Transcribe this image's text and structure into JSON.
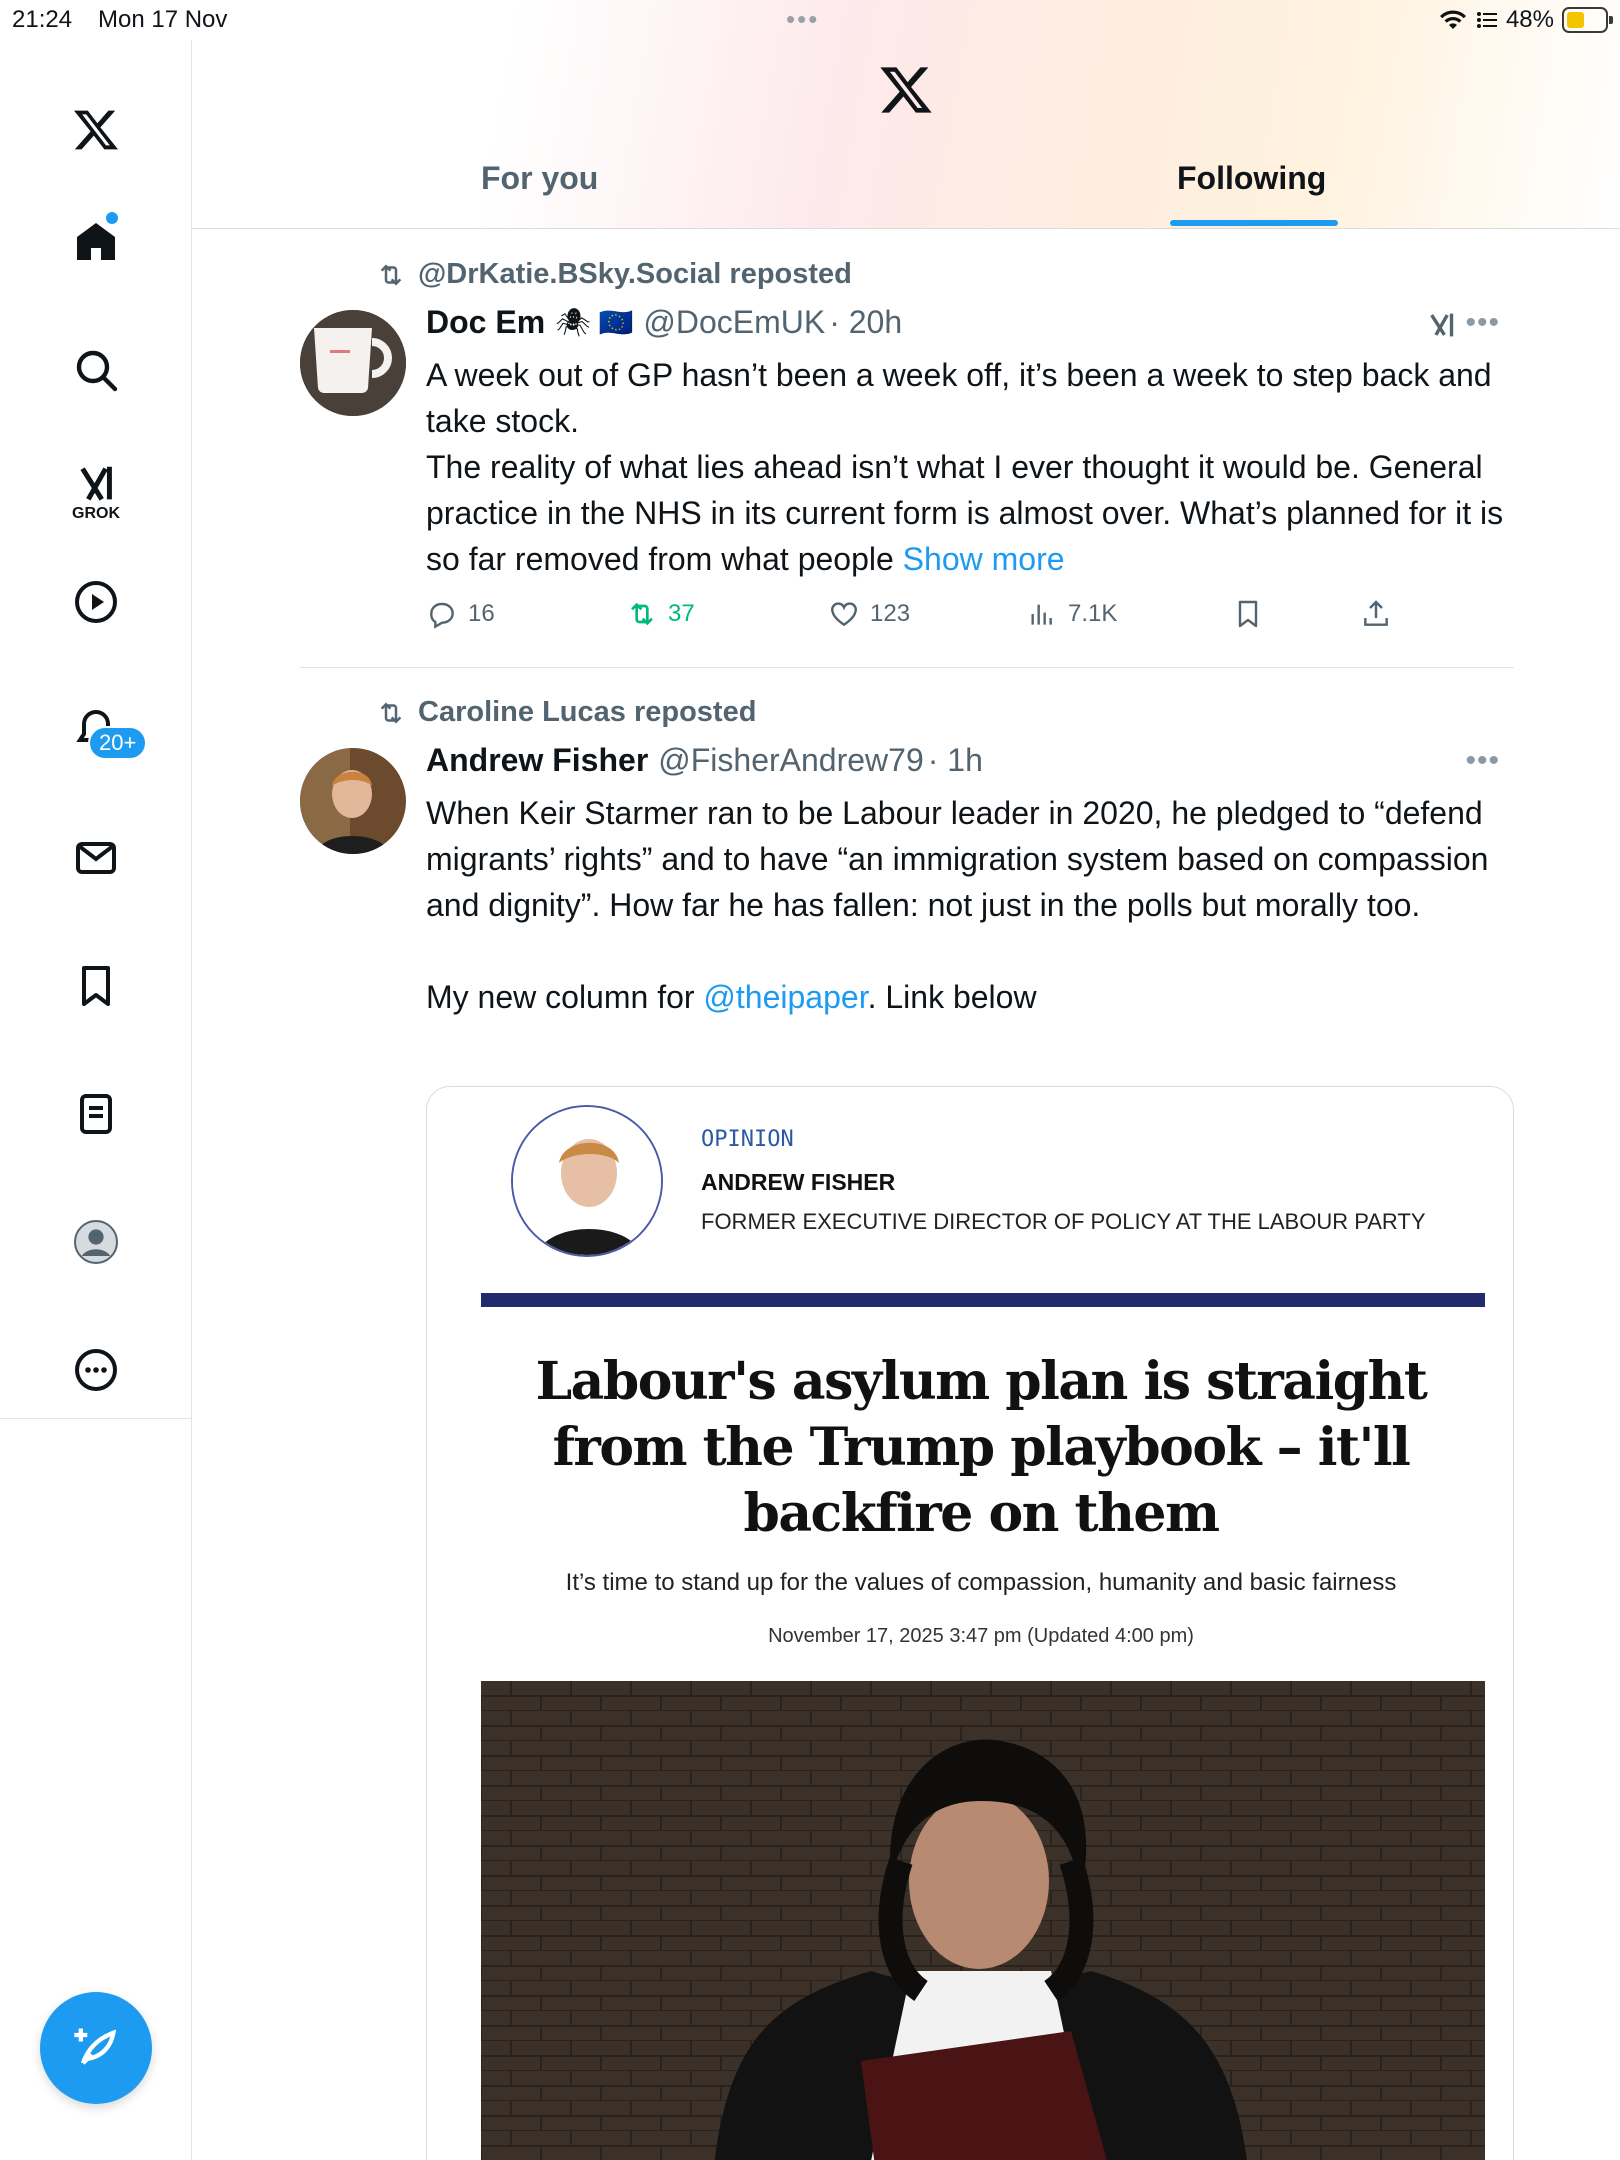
{
  "status_bar": {
    "time": "21:24",
    "date": "Mon 17 Nov",
    "battery": "48%"
  },
  "sidebar": {
    "items": [
      "x-logo",
      "home",
      "search",
      "grok",
      "video",
      "notifications",
      "messages",
      "bookmarks",
      "lists",
      "profile",
      "more"
    ],
    "grok_label": "GROK",
    "notifications_badge": "20+"
  },
  "tabs": {
    "for_you": "For you",
    "following": "Following",
    "active": "Following"
  },
  "tweets": [
    {
      "repost_by": "@DrKatie.BSky.Social reposted",
      "name": "Doc Em",
      "name_emoji": "🕷 🇪🇺",
      "handle": "@DocEmUK",
      "time": "· 20h",
      "text_1": "A week out of GP hasn’t been a week off, it’s been a week to step back and take stock.",
      "text_2": "The reality of what lies ahead isn’t what I ever thought it would be. General practice in the NHS in its current form is almost over. What’s planned for it is so far removed from what people",
      "show_more": "Show more",
      "replies": "16",
      "reposts": "37",
      "likes": "123",
      "views": "7.1K"
    },
    {
      "repost_by": "Caroline Lucas reposted",
      "name": "Andrew Fisher",
      "handle": "@FisherAndrew79",
      "time": "· 1h",
      "text_1": "When Keir Starmer ran to be Labour leader in 2020, he pledged to “defend migrants’ rights” and to have “an immigration system based on compassion and dignity”. How far he has fallen: not just in the polls but morally too.",
      "text_2_prefix": "My new column for ",
      "text_2_mention": "@theipaper",
      "text_2_suffix": ". Link below",
      "card": {
        "kicker": "OPINION",
        "author": "ANDREW FISHER",
        "role": "FORMER EXECUTIVE DIRECTOR OF POLICY AT THE LABOUR PARTY",
        "headline": "Labour's asylum plan is straight from the Trump playbook – it'll backfire on them",
        "standfirst": "It’s time to stand up for the values of compassion, humanity and basic fairness",
        "dateline": "November 17, 2025 3:47 pm (Updated 4:00 pm)"
      }
    }
  ],
  "colors": {
    "accent": "#1d9bf0",
    "repost_green": "#00ba7c",
    "muted": "#536471",
    "card_rule": "#222a6e"
  }
}
